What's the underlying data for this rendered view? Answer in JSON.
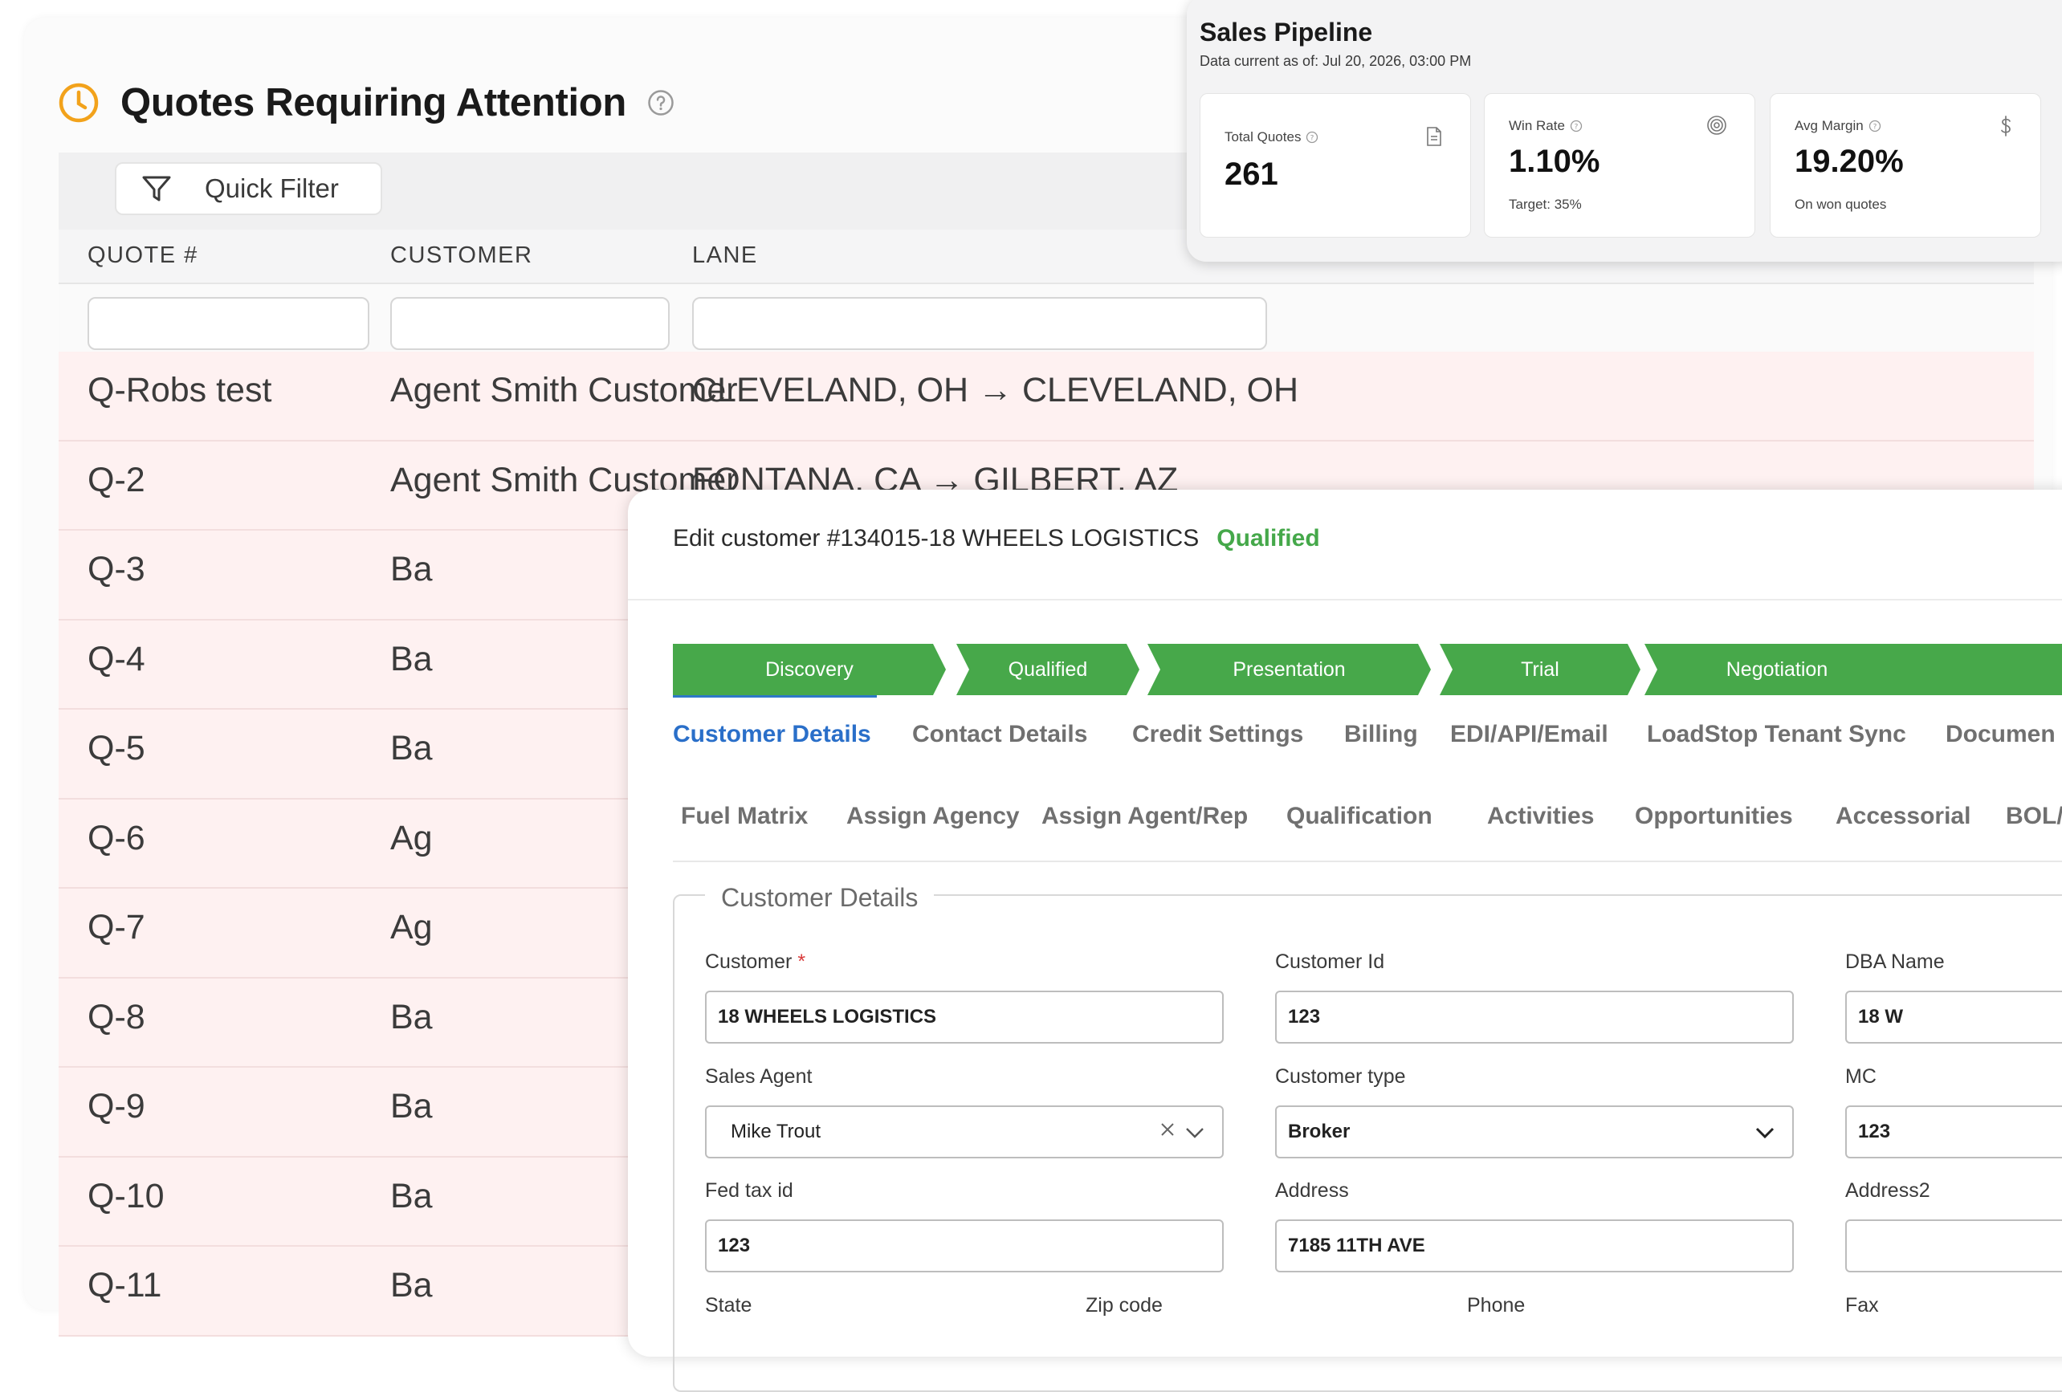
{
  "quotes": {
    "title": "Quotes Requiring Attention",
    "quick_filter_label": "Quick Filter",
    "columns": [
      "QUOTE #",
      "CUSTOMER",
      "LANE"
    ],
    "rows": [
      {
        "quote": "Q-Robs test",
        "customer": "Agent Smith Customer",
        "lane": "CLEVELAND, OH → CLEVELAND, OH"
      },
      {
        "quote": "Q-2",
        "customer": "Agent Smith Customer",
        "lane": "FONTANA, CA → GILBERT, AZ"
      },
      {
        "quote": "Q-3",
        "customer": "Ba",
        "lane": ""
      },
      {
        "quote": "Q-4",
        "customer": "Ba",
        "lane": ""
      },
      {
        "quote": "Q-5",
        "customer": "Ba",
        "lane": ""
      },
      {
        "quote": "Q-6",
        "customer": "Ag",
        "lane": ""
      },
      {
        "quote": "Q-7",
        "customer": "Ag",
        "lane": ""
      },
      {
        "quote": "Q-8",
        "customer": "Ba",
        "lane": ""
      },
      {
        "quote": "Q-9",
        "customer": "Ba",
        "lane": ""
      },
      {
        "quote": "Q-10",
        "customer": "Ba",
        "lane": ""
      },
      {
        "quote": "Q-11",
        "customer": "Ba",
        "lane": ""
      }
    ],
    "colors": {
      "row_bg": "#fef1f1",
      "clock": "#f2a21b"
    }
  },
  "pipeline": {
    "title": "Sales Pipeline",
    "subtitle": "Data current as of: Jul 20, 2026, 03:00 PM",
    "stats": [
      {
        "label": "Total Quotes",
        "value": "261",
        "note": "",
        "icon": "document-icon"
      },
      {
        "label": "Win Rate",
        "value": "1.10%",
        "note": "Target: 35%",
        "icon": "target-icon"
      },
      {
        "label": "Avg Margin",
        "value": "19.20%",
        "note": "On won quotes",
        "icon": "dollar-icon"
      }
    ]
  },
  "edit_customer": {
    "title": "Edit customer #134015-18 WHEELS LOGISTICS",
    "status": "Qualified",
    "status_color": "#45a84a",
    "stages": [
      "Discovery",
      "Qualified",
      "Presentation",
      "Trial",
      "Negotiation"
    ],
    "stage_color": "#47a84a",
    "tabs_row1": [
      "Customer Details",
      "Contact Details",
      "Credit Settings",
      "Billing",
      "EDI/API/Email",
      "LoadStop Tenant Sync",
      "Documen"
    ],
    "tabs_row2": [
      "Fuel Matrix",
      "Assign Agency",
      "Assign Agent/Rep",
      "Qualification",
      "Activities",
      "Opportunities",
      "Accessorial",
      "BOL/"
    ],
    "section_title": "Customer Details",
    "fields": {
      "customer_label": "Customer",
      "required_mark": "*",
      "customer_value": "18 WHEELS LOGISTICS",
      "customer_id_label": "Customer Id",
      "customer_id_value": "123",
      "dba_label": "DBA Name",
      "dba_value": "18 W",
      "sales_agent_label": "Sales Agent",
      "sales_agent_value": "Mike Trout",
      "customer_type_label": "Customer type",
      "customer_type_value": "Broker",
      "mc_label": "MC",
      "mc_value": "123",
      "fed_tax_label": "Fed tax id",
      "fed_tax_value": "123",
      "address_label": "Address",
      "address_value": "7185 11TH AVE",
      "address2_label": "Address2",
      "address2_value": "",
      "state_label": "State",
      "zip_label": "Zip code",
      "phone_label": "Phone",
      "fax_label": "Fax"
    }
  }
}
